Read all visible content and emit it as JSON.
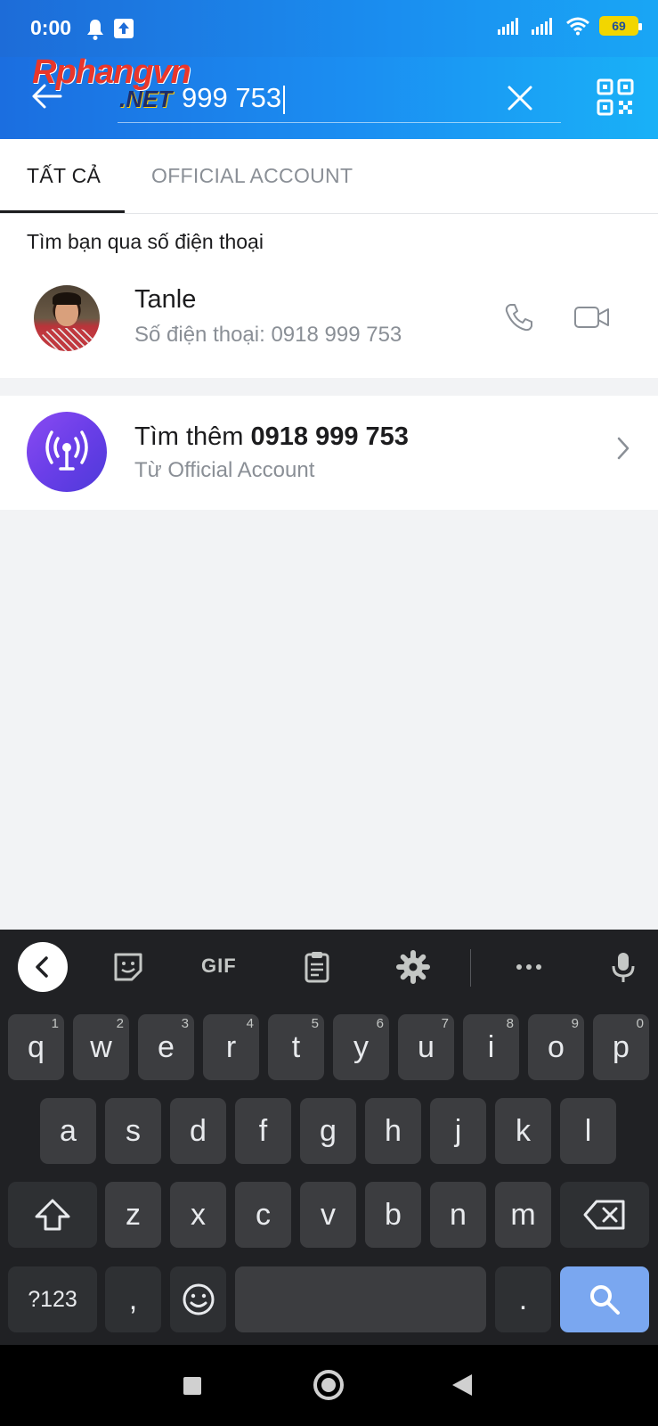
{
  "status_bar": {
    "time": "0:00",
    "battery": "69"
  },
  "header": {
    "search_value": "0918 999 753",
    "search_visible_text": "999 753",
    "watermark": "Rphangvn",
    "watermark_suffix": ".NET"
  },
  "tabs": [
    {
      "label": "TẤT CẢ",
      "active": true
    },
    {
      "label": "OFFICIAL ACCOUNT",
      "active": false
    }
  ],
  "phone_section": {
    "title": "Tìm bạn qua số điện thoại",
    "contact": {
      "name": "Tanle",
      "phone": "Số điện thoại: 0918 999 753"
    }
  },
  "official_account": {
    "prefix": "Tìm thêm ",
    "number": "0918 999 753",
    "subtitle": "Từ Official Account"
  },
  "keyboard": {
    "toolbar_gif": "GIF",
    "row1": [
      {
        "k": "q",
        "h": "1"
      },
      {
        "k": "w",
        "h": "2"
      },
      {
        "k": "e",
        "h": "3"
      },
      {
        "k": "r",
        "h": "4"
      },
      {
        "k": "t",
        "h": "5"
      },
      {
        "k": "y",
        "h": "6"
      },
      {
        "k": "u",
        "h": "7"
      },
      {
        "k": "i",
        "h": "8"
      },
      {
        "k": "o",
        "h": "9"
      },
      {
        "k": "p",
        "h": "0"
      }
    ],
    "row2": [
      "a",
      "s",
      "d",
      "f",
      "g",
      "h",
      "j",
      "k",
      "l"
    ],
    "row3": [
      "z",
      "x",
      "c",
      "v",
      "b",
      "n",
      "m"
    ],
    "symbols_key": "?123",
    "comma_key": ",",
    "period_key": "."
  },
  "colors": {
    "header_start": "#1b6ee0",
    "header_end": "#19b1f7",
    "oa_purple": "#6a3ee8",
    "search_key": "#7aa7f0"
  }
}
